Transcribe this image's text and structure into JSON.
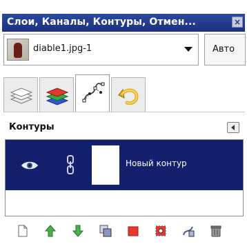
{
  "window": {
    "title": "Слои, Каналы, Контуры, Отмен...",
    "close_icon": "close-icon"
  },
  "image_selector": {
    "current": "diable1.jpg-1",
    "auto_label": "Авто"
  },
  "tabs": [
    {
      "name": "layers",
      "icon": "layers-icon",
      "active": false
    },
    {
      "name": "channels",
      "icon": "channels-icon",
      "active": false
    },
    {
      "name": "paths",
      "icon": "paths-icon",
      "active": true
    },
    {
      "name": "undo-history",
      "icon": "undo-history-icon",
      "active": false
    }
  ],
  "panel": {
    "title": "Контуры",
    "paths": [
      {
        "label": "Новый контур",
        "visible": true,
        "linked": true,
        "selected": true
      }
    ]
  },
  "toolbar": [
    "new-path-icon",
    "raise-path-icon",
    "lower-path-icon",
    "duplicate-path-icon",
    "path-to-selection-icon",
    "selection-to-path-icon",
    "stroke-path-icon",
    "delete-path-icon"
  ],
  "colors": {
    "titlebar": "#1c2f7e",
    "selected_row": "#12206e"
  }
}
